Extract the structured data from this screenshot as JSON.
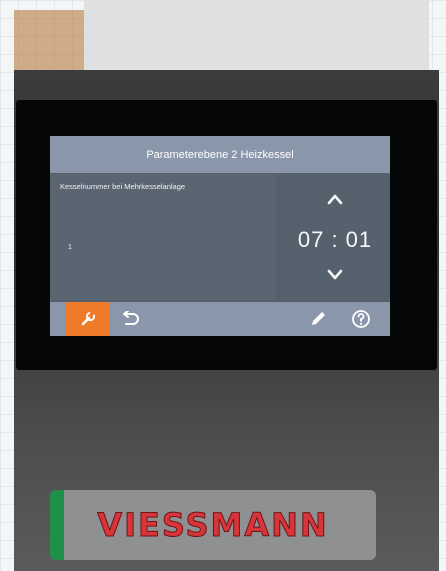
{
  "screen": {
    "title": "Parameterebene 2 Heizkessel",
    "parameter": {
      "label": "Kesselnummer bei Mehrkesselanlage",
      "value": "1"
    },
    "time": {
      "text": "07 : 01"
    }
  },
  "toolbar": {
    "items": [
      "wrench-icon",
      "back-arrow-icon",
      "edit-pencil-icon",
      "help-icon"
    ],
    "active_color": "#ee7b2a"
  },
  "brand": {
    "name": "VIESSMANN"
  },
  "colors": {
    "screen_bar": "#8a96aa",
    "panel": "#5b6572",
    "accent": "#ee7b2a"
  }
}
